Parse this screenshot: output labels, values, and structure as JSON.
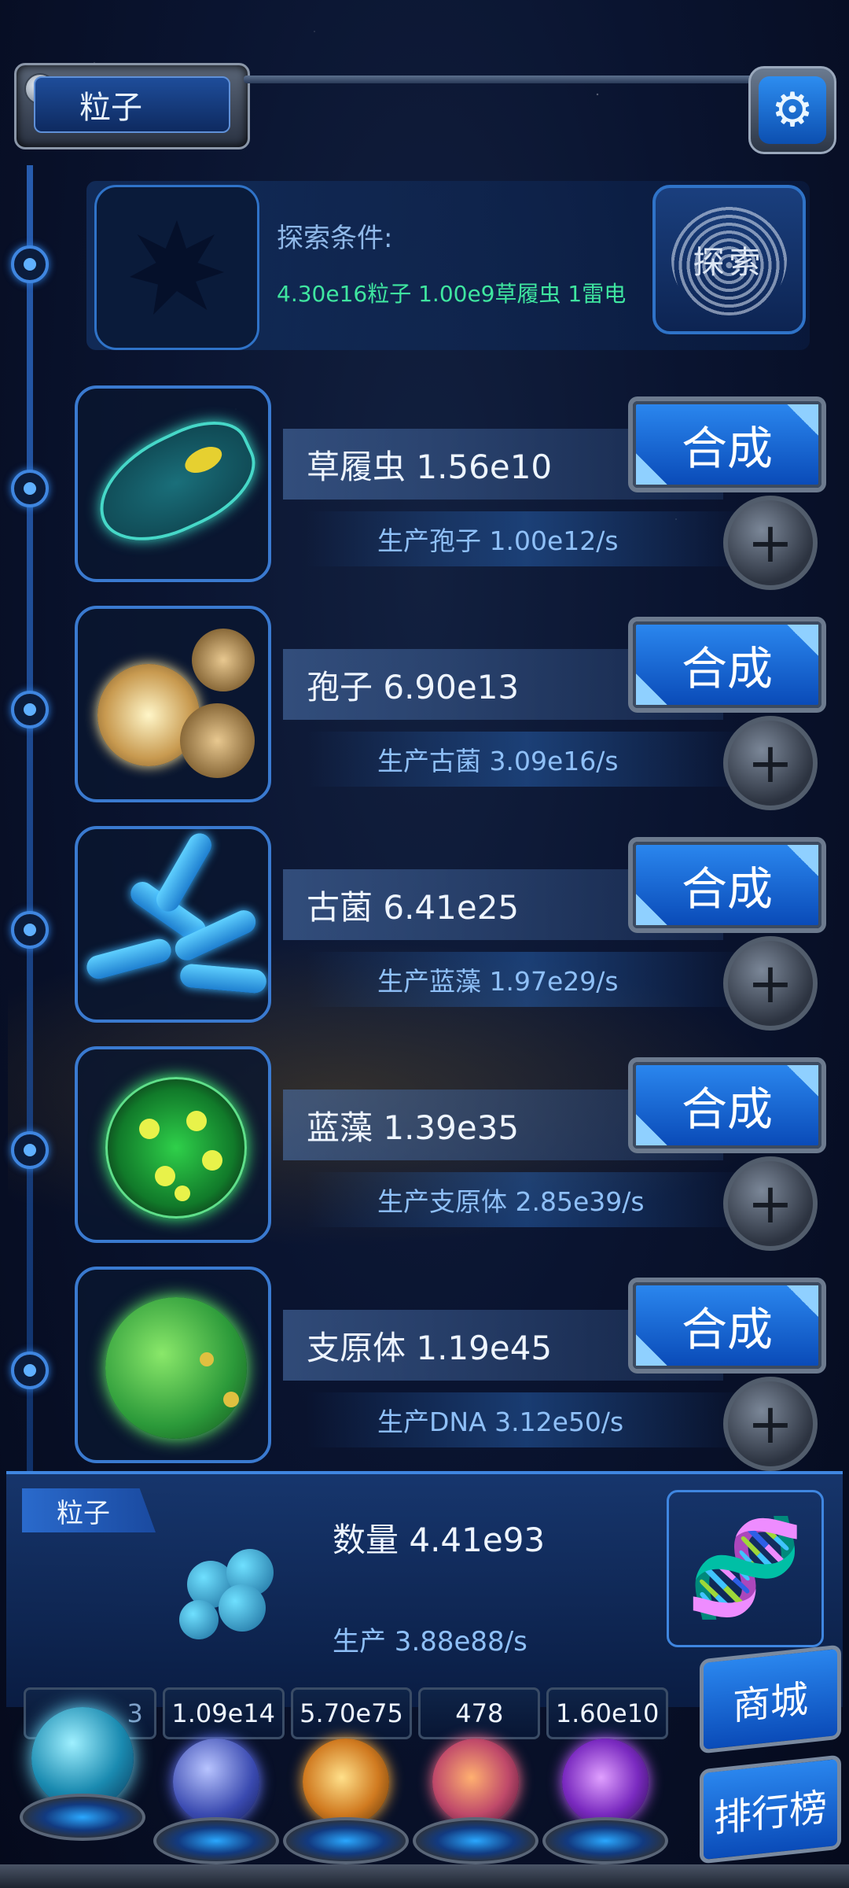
{
  "header": {
    "title": "粒子",
    "settings_icon": "gear-icon"
  },
  "explore": {
    "label": "探索条件:",
    "condition": "4.30e16粒子 1.00e9草履虫 1雷电",
    "button_label": "探索"
  },
  "rows": [
    {
      "name": "草履虫 1.56e10",
      "production": "生产孢子 1.00e12/s",
      "merge_label": "合成"
    },
    {
      "name": "孢子 6.90e13",
      "production": "生产古菌 3.09e16/s",
      "merge_label": "合成"
    },
    {
      "name": "古菌 6.41e25",
      "production": "生产蓝藻 1.97e29/s",
      "merge_label": "合成"
    },
    {
      "name": "蓝藻 1.39e35",
      "production": "生产支原体 2.85e39/s",
      "merge_label": "合成"
    },
    {
      "name": "支原体 1.19e45",
      "production": "生产DNA 3.12e50/s",
      "merge_label": "合成"
    }
  ],
  "particle": {
    "tab": "粒子",
    "count": "数量 4.41e93",
    "rate": "生产 3.88e88/s"
  },
  "resources": [
    "3",
    "1.09e14",
    "5.70e75",
    "478",
    "1.60e10"
  ],
  "side": {
    "shop": "商城",
    "ranking": "排行榜"
  },
  "colors": {
    "accent": "#2a86ee",
    "condition_text": "#3fe6a0",
    "production_text": "#8fc0f8"
  }
}
